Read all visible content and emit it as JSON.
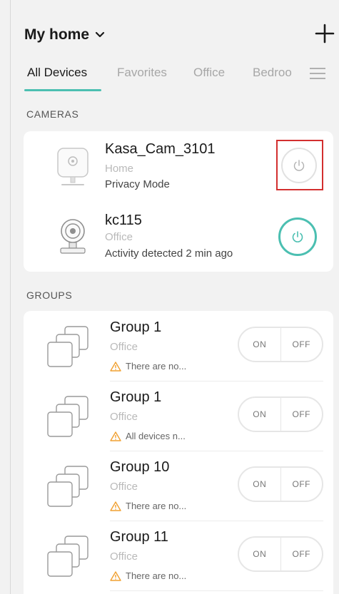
{
  "header": {
    "home_title": "My home",
    "home_chevron_icon": "chevron-down-icon",
    "add_icon": "plus-icon"
  },
  "tabs": [
    {
      "label": "All Devices",
      "active": true
    },
    {
      "label": "Favorites",
      "active": false
    },
    {
      "label": "Office",
      "active": false
    },
    {
      "label": "Bedroo",
      "active": false
    }
  ],
  "tabs_menu_icon": "hamburger-menu-icon",
  "colors": {
    "accent": "#4bbfb1",
    "highlight": "#d32f2f",
    "warning": "#f0a030",
    "background": "#f2f2f2"
  },
  "sections": {
    "cameras": "CAMERAS",
    "groups": "GROUPS"
  },
  "cameras": [
    {
      "name": "Kasa_Cam_3101",
      "room": "Home",
      "status": "Privacy Mode",
      "power": "off",
      "icon": "security-camera-icon"
    },
    {
      "name": "kc115",
      "room": "Office",
      "status": "Activity detected 2 min ago",
      "power": "on",
      "icon": "webcam-icon"
    }
  ],
  "groups": [
    {
      "name": "Group 1",
      "room": "Office",
      "warning": "There are no...",
      "on_label": "ON",
      "off_label": "OFF"
    },
    {
      "name": "Group 1",
      "room": "Office",
      "warning": "All devices n...",
      "on_label": "ON",
      "off_label": "OFF"
    },
    {
      "name": "Group 10",
      "room": "Office",
      "warning": "There are no...",
      "on_label": "ON",
      "off_label": "OFF"
    },
    {
      "name": "Group 11",
      "room": "Office",
      "warning": "There are no...",
      "on_label": "ON",
      "off_label": "OFF"
    }
  ]
}
